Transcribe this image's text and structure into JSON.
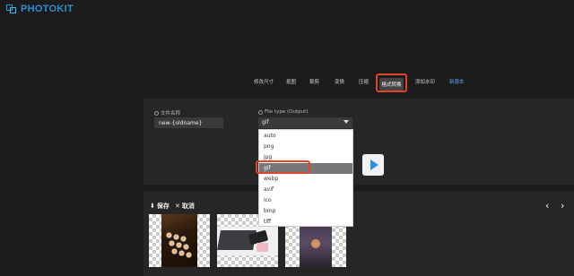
{
  "brand": {
    "name": "PHOTOKIT"
  },
  "nav": {
    "items": [
      "修改尺寸",
      "抠图",
      "裁剪",
      "变换",
      "压缩",
      "格式转换",
      "添加水印",
      "新版本"
    ],
    "active": "格式转换"
  },
  "form": {
    "filename_label": "文件名称",
    "filename_value": "new-{oldname}",
    "filetype_label": "File type (Output)",
    "filetype_value": "gif"
  },
  "dropdown": {
    "options": [
      "auto",
      "png",
      "jpg",
      "gif",
      "webp",
      "avif",
      "ico",
      "bmp",
      "tiff"
    ],
    "selected": "gif"
  },
  "bottom": {
    "save_label": "保存",
    "cancel_label": "取消",
    "save_icon": "download-icon",
    "cancel_icon": "close-icon"
  },
  "colors": {
    "brand": "#2a8fd6",
    "highlight": "#e0452b",
    "accent": "#2e8fe0"
  }
}
